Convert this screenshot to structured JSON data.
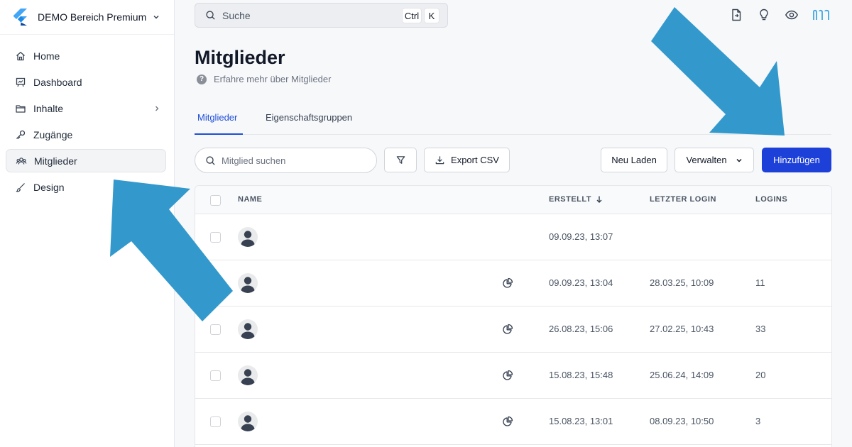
{
  "sidebar": {
    "workspace_name": "DEMO Bereich Premium",
    "items": [
      {
        "label": "Home",
        "icon": "home-icon"
      },
      {
        "label": "Dashboard",
        "icon": "presentation-icon"
      },
      {
        "label": "Inhalte",
        "icon": "folder-icon",
        "has_submenu": true
      },
      {
        "label": "Zugänge",
        "icon": "key-icon"
      },
      {
        "label": "Mitglieder",
        "icon": "users-icon",
        "active": true
      },
      {
        "label": "Design",
        "icon": "brush-icon",
        "has_submenu": true
      }
    ]
  },
  "topbar": {
    "search_label": "Suche",
    "shortcut_ctrl": "Ctrl",
    "shortcut_key": "K",
    "icons": [
      "file-arrow-icon",
      "lightbulb-icon",
      "eye-icon",
      "brand-logo-icon"
    ]
  },
  "header": {
    "title": "Mitglieder",
    "help_text": "Erfahre mehr über Mitglieder"
  },
  "tabs": [
    {
      "label": "Mitglieder",
      "active": true
    },
    {
      "label": "Eigenschaftsgruppen",
      "active": false
    }
  ],
  "toolbar": {
    "search_placeholder": "Mitglied suchen",
    "export_label": "Export CSV",
    "reload_label": "Neu Laden",
    "manage_label": "Verwalten",
    "add_label": "Hinzufügen"
  },
  "table": {
    "columns": {
      "name": "NAME",
      "created": "ERSTELLT",
      "last_login": "LETZTER LOGIN",
      "logins": "LOGINS"
    },
    "rows": [
      {
        "created": "09.09.23, 13:07",
        "last_login": "",
        "logins": "",
        "has_segment": false
      },
      {
        "created": "09.09.23, 13:04",
        "last_login": "28.03.25, 10:09",
        "logins": "11",
        "has_segment": true
      },
      {
        "created": "26.08.23, 15:06",
        "last_login": "27.02.25, 10:43",
        "logins": "33",
        "has_segment": true
      },
      {
        "created": "15.08.23, 15:48",
        "last_login": "25.06.24, 14:09",
        "logins": "20",
        "has_segment": true
      },
      {
        "created": "15.08.23, 13:01",
        "last_login": "08.09.23, 10:50",
        "logins": "3",
        "has_segment": true
      }
    ]
  },
  "colors": {
    "primary": "#1d40d9",
    "tab_active": "#1d4ed8",
    "annotation_arrow": "#3399cc",
    "brand_logo": "#40a9e0"
  }
}
